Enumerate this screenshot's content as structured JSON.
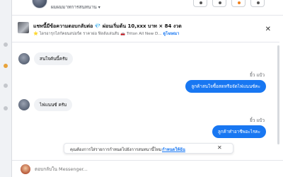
{
  "header": {
    "contact_name": "ผมผมมาทการสนทนาน",
    "chevron_icon": "chevron-down-icon",
    "buttons": [
      "phone-icon",
      "info-icon",
      "tag-icon",
      "more-icon"
    ]
  },
  "listing_banner": {
    "title": "แชทนี้มีข้อความตอบกลับต่อ 💎 ผ่อนเริ่มต้น 10,xxx บาท × 84 งวด",
    "subtitle": "⭐ ไดรอารุกไสกัคยนสปอร์ต ราคาผ่อ ฟิลลังเล่นสับ 🚗 Triton All New D...",
    "link_label": "ดูโฆษณา",
    "close_icon": "close-icon"
  },
  "messages": [
    {
      "direction": "in",
      "text": "สนใจคันนี้ครับ"
    },
    {
      "direction": "out",
      "status": "ยิ้ว แบ้ว",
      "text": "ลูกค้าสนใจซื้อสดหรือจัดไฟแนนซ์คะ"
    },
    {
      "direction": "in",
      "text": "ไฟแนนซ์ ครับ"
    },
    {
      "direction": "out",
      "status": "ยิ้ว แบ้ว",
      "text": "ลูกค้าทำอาชีพอะไรคะ"
    }
  ],
  "suggestion": {
    "text": "คุณต้องการใส่รายการกำหนดไปยังการสนทนานี้ไหม",
    "link_label": "กำหนดให้ฉัน",
    "close_icon": "close-icon"
  },
  "composer": {
    "placeholder": "ตอบกลับใน Messenger..."
  },
  "colors": {
    "accent": "#1877f2",
    "incoming_bubble": "#f0f2f5",
    "muted_text": "#65676b"
  }
}
